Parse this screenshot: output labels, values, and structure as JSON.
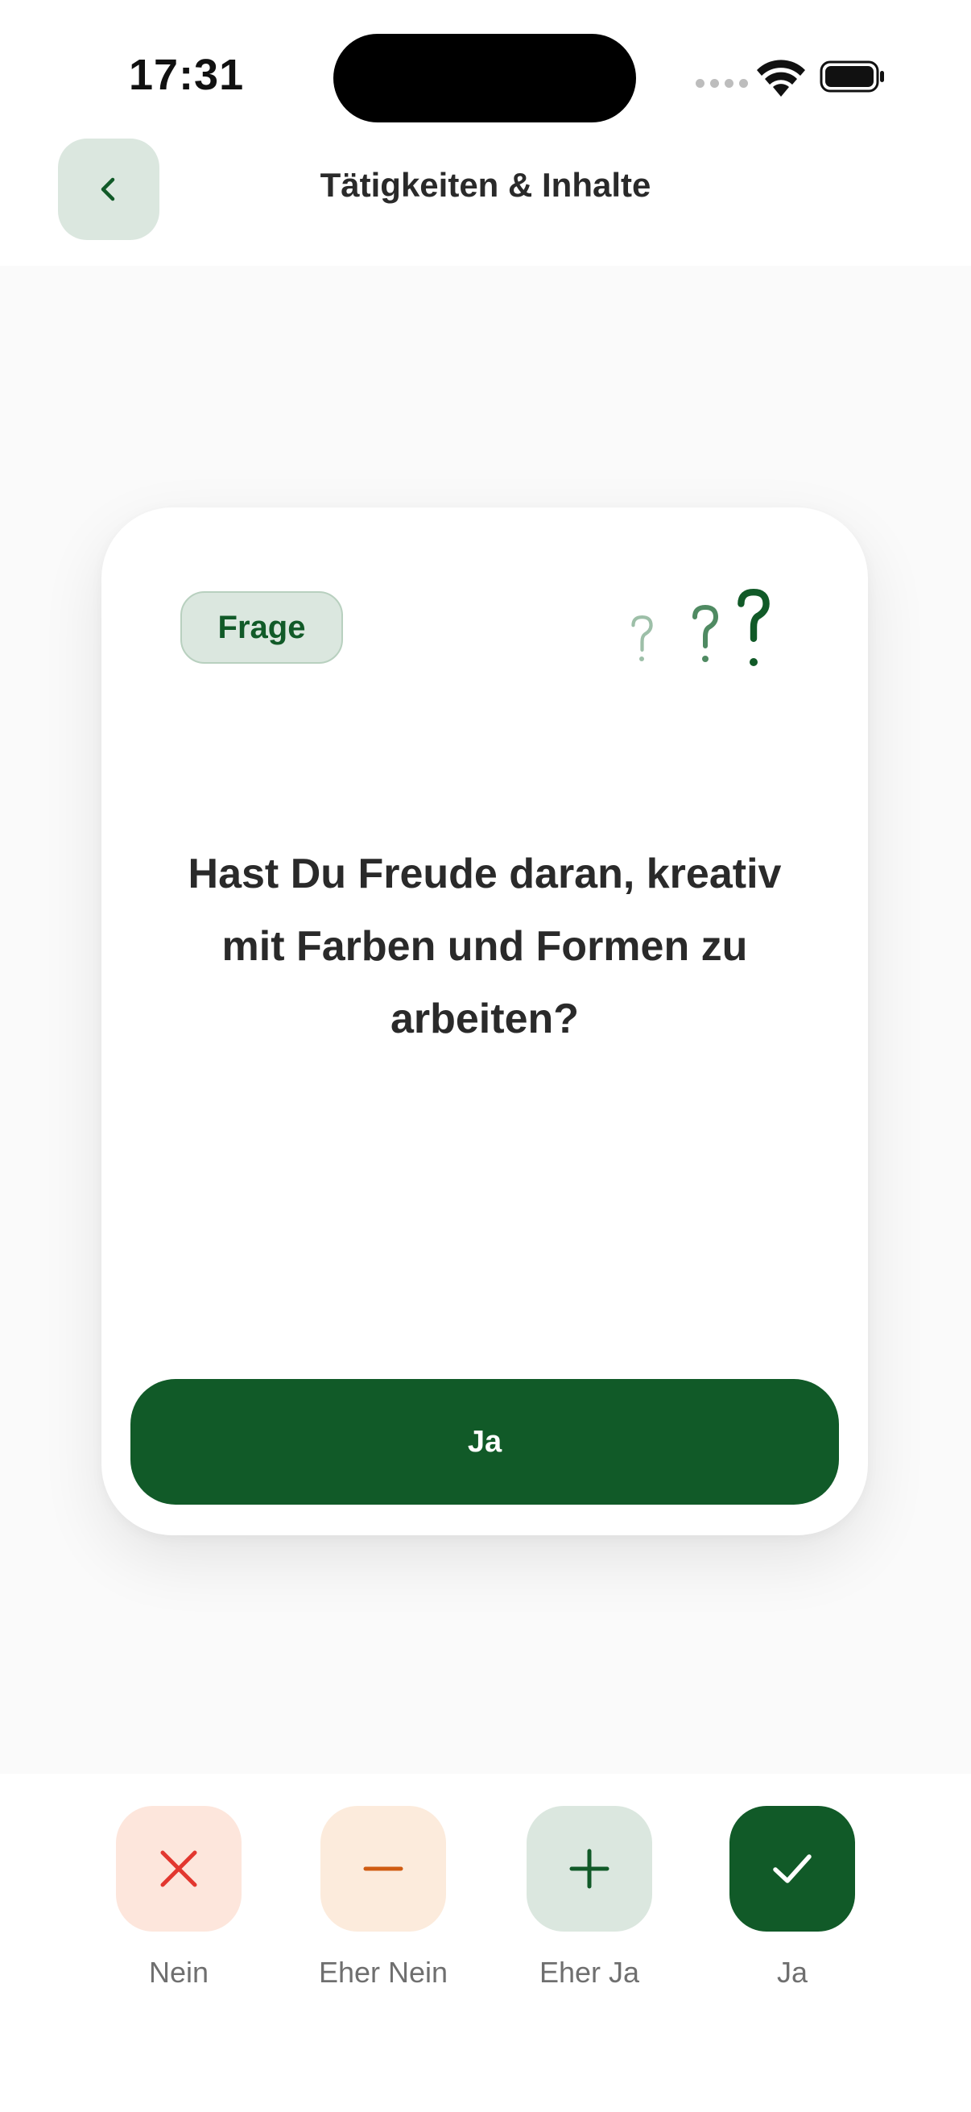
{
  "status_bar": {
    "time": "17:31",
    "icons": [
      "signal-dots-icon",
      "wifi-icon",
      "battery-icon"
    ]
  },
  "header": {
    "back_icon": "chevron-left-icon",
    "title": "Tätigkeiten & Inhalte"
  },
  "card": {
    "badge": "Frage",
    "question": "Hast Du Freude daran, kreativ mit Farben und Formen zu arbeiten?",
    "decor_icon": "question-marks-icon",
    "answer_button": "Ja"
  },
  "choices": [
    {
      "label": "Nein",
      "icon": "close-icon",
      "color": "#e2372f",
      "background": "#fde6dc"
    },
    {
      "label": "Eher Nein",
      "icon": "minus-icon",
      "color": "#cf5b12",
      "background": "#fcebdc"
    },
    {
      "label": "Eher Ja",
      "icon": "plus-icon",
      "color": "#115a28",
      "background": "#dbe7df"
    },
    {
      "label": "Ja",
      "icon": "check-icon",
      "color": "#ffffff",
      "background": "#115a28"
    }
  ],
  "colors": {
    "accent": "#115a28",
    "accent_soft": "#dbe7df",
    "negative": "#e2372f",
    "warning": "#cf5b12",
    "background": "#fafafa"
  }
}
